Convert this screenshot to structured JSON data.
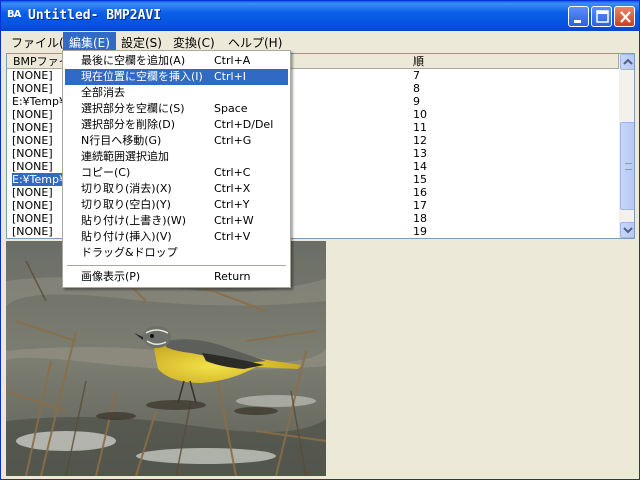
{
  "window": {
    "app_icon": "BA",
    "title": "Untitled- BMP2AVI",
    "controls": [
      "minimize-icon",
      "maximize-icon",
      "close-icon"
    ]
  },
  "menubar": {
    "items": [
      {
        "label": "ファイル(F)"
      },
      {
        "label": "編集(E)"
      },
      {
        "label": "設定(S)"
      },
      {
        "label": "変換(C)"
      },
      {
        "label": "ヘルプ(H)"
      }
    ]
  },
  "list": {
    "columns": [
      "BMPファイ",
      "順"
    ],
    "rows": [
      {
        "file": "[NONE]",
        "order": "7"
      },
      {
        "file": "[NONE]",
        "order": "8"
      },
      {
        "file": "E:¥Temp¥",
        "order": "9"
      },
      {
        "file": "[NONE]",
        "order": "10"
      },
      {
        "file": "[NONE]",
        "order": "11"
      },
      {
        "file": "[NONE]",
        "order": "12"
      },
      {
        "file": "[NONE]",
        "order": "13"
      },
      {
        "file": "[NONE]",
        "order": "14"
      },
      {
        "file": "E:¥Temp¥",
        "order": "15"
      },
      {
        "file": "[NONE]",
        "order": "16"
      },
      {
        "file": "[NONE]",
        "order": "17"
      },
      {
        "file": "[NONE]",
        "order": "18"
      },
      {
        "file": "[NONE]",
        "order": "19"
      }
    ]
  },
  "edit_menu": {
    "items": [
      {
        "label": "最後に空欄を追加(A)",
        "shortcut": "Ctrl+A"
      },
      {
        "label": "現在位置に空欄を挿入(I)",
        "shortcut": "Ctrl+I"
      },
      {
        "label": "全部消去",
        "shortcut": ""
      },
      {
        "label": "選択部分を空欄に(S)",
        "shortcut": "Space"
      },
      {
        "label": "選択部分を削除(D)",
        "shortcut": "Ctrl+D/Del"
      },
      {
        "label": "N行目へ移動(G)",
        "shortcut": "Ctrl+G"
      },
      {
        "label": "連続範囲選択追加",
        "shortcut": ""
      },
      {
        "label": "コピー(C)",
        "shortcut": "Ctrl+C"
      },
      {
        "label": "切り取り(消去)(X)",
        "shortcut": "Ctrl+X"
      },
      {
        "label": "切り取り(空白)(Y)",
        "shortcut": "Ctrl+Y"
      },
      {
        "label": "貼り付け(上書き)(W)",
        "shortcut": "Ctrl+W"
      },
      {
        "label": "貼り付け(挿入)(V)",
        "shortcut": "Ctrl+V"
      },
      {
        "label": "ドラッグ&ドロップ",
        "shortcut": ""
      },
      {
        "label": "画像表示(P)",
        "shortcut": "Return"
      }
    ]
  },
  "colors": {
    "selection": "#316ac5",
    "titlebar": "#0a5ee8",
    "face": "#ece9d8"
  }
}
